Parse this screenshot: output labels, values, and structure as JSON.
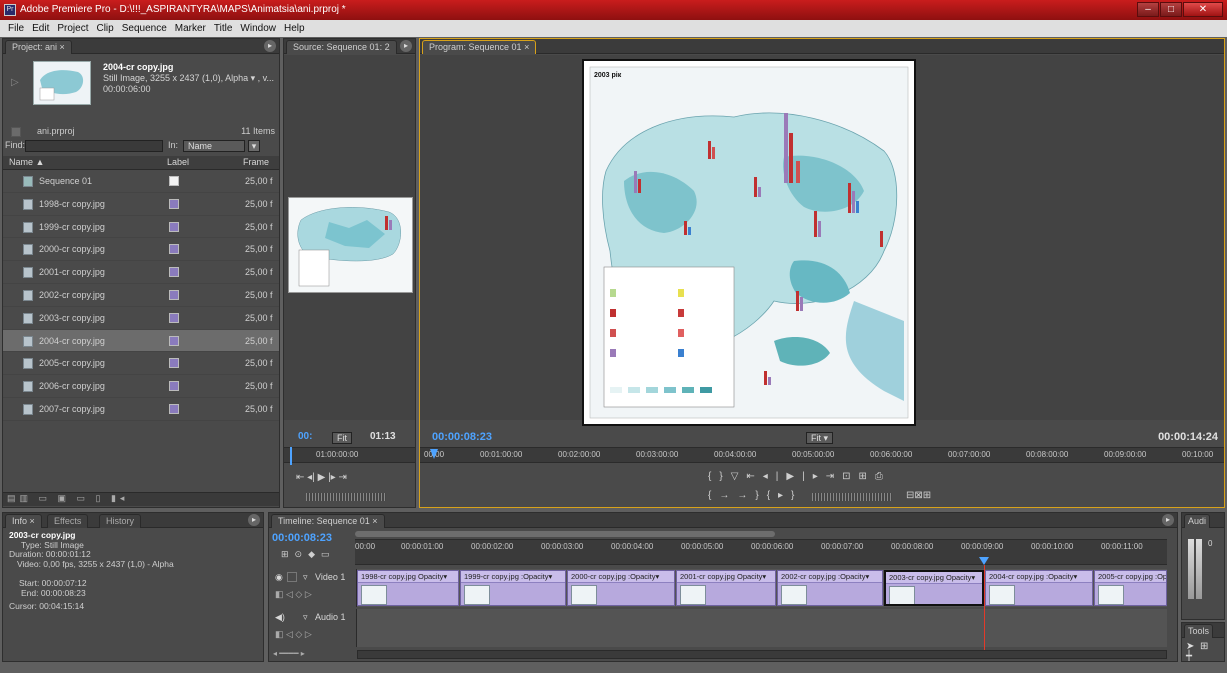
{
  "window": {
    "title": "Adobe Premiere Pro - D:\\!!!_ASPIRANTYRA\\MAPS\\Animatsia\\ani.prproj *",
    "app_icon": "Pr"
  },
  "menu": [
    "File",
    "Edit",
    "Project",
    "Clip",
    "Sequence",
    "Marker",
    "Title",
    "Window",
    "Help"
  ],
  "project": {
    "tab": "Project: ani",
    "selected_name": "2004-cr copy.jpg",
    "selected_detail": "Still Image, 3255 x 2437 (1,0), Alpha ▾ , v...",
    "selected_duration": "00:00:06:00",
    "file": "ani.prproj",
    "count": "11 Items",
    "find_label": "Find:",
    "in_label": "In:",
    "in_value": "Name",
    "col_name": "Name ▲",
    "col_label": "Label",
    "col_frame": "Frame",
    "items": [
      {
        "name": "Sequence 01",
        "frame": "25,00 f",
        "label": "white"
      },
      {
        "name": "1998-cr copy.jpg",
        "frame": "25,00 f",
        "label": "violet"
      },
      {
        "name": "1999-cr copy.jpg",
        "frame": "25,00 f",
        "label": "violet"
      },
      {
        "name": "2000-cr copy.jpg",
        "frame": "25,00 f",
        "label": "violet"
      },
      {
        "name": "2001-cr copy.jpg",
        "frame": "25,00 f",
        "label": "violet"
      },
      {
        "name": "2002-cr copy.jpg",
        "frame": "25,00 f",
        "label": "violet"
      },
      {
        "name": "2003-cr copy.jpg",
        "frame": "25,00 f",
        "label": "violet"
      },
      {
        "name": "2004-cr copy.jpg",
        "frame": "25,00 f",
        "label": "violet",
        "selected": true
      },
      {
        "name": "2005-cr copy.jpg",
        "frame": "25,00 f",
        "label": "violet"
      },
      {
        "name": "2006-cr copy.jpg",
        "frame": "25,00 f",
        "label": "violet"
      },
      {
        "name": "2007-cr copy.jpg",
        "frame": "25,00 f",
        "label": "violet"
      }
    ]
  },
  "source": {
    "tab": "Source: Sequence 01: 2",
    "tc_left": "00:",
    "fit": "Fit",
    "tc_right": "01:13",
    "ruler_tc": "01:00:00:00"
  },
  "program": {
    "tab": "Program: Sequence 01",
    "tc_current": "00:00:08:23",
    "fit": "Fit",
    "tc_duration": "00:00:14:24",
    "map_title": "2003 рік",
    "ruler": [
      "00:00",
      "00:01:00:00",
      "00:02:00:00",
      "00:03:00:00",
      "00:04:00:00",
      "00:05:00:00",
      "00:06:00:00",
      "00:07:00:00",
      "00:08:00:00",
      "00:09:00:00",
      "00:10:00"
    ]
  },
  "info": {
    "tabs": [
      "Info",
      "Effects",
      "History"
    ],
    "name": "2003-cr copy.jpg",
    "type": "Type: Still Image",
    "duration": "Duration: 00:00:01:12",
    "video": "Video: 0,00 fps, 3255 x 2437 (1,0) - Alpha",
    "start": "Start: 00:00:07:12",
    "end": "End: 00:00:08:23",
    "cursor": "Cursor: 00:04:15:14"
  },
  "timeline": {
    "tab": "Timeline: Sequence 01",
    "tc": "00:00:08:23",
    "ruler": [
      "00:00",
      "00:00:01:00",
      "00:00:02:00",
      "00:00:03:00",
      "00:00:04:00",
      "00:00:05:00",
      "00:00:06:00",
      "00:00:07:00",
      "00:00:08:00",
      "00:00:09:00",
      "00:00:10:00",
      "00:00:11:00"
    ],
    "video_track": "Video 1",
    "audio_track": "Audio 1",
    "clips": [
      {
        "name": "1998-cr copy.jpg",
        "fx": "Opacity▾"
      },
      {
        "name": "1999-cr copy.jpg",
        "fx": ":Opacity▾"
      },
      {
        "name": "2000-cr copy.jpg",
        "fx": ":Opacity▾"
      },
      {
        "name": "2001-cr copy.jpg",
        "fx": "Opacity▾"
      },
      {
        "name": "2002-cr copy.jpg",
        "fx": ":Opacity▾"
      },
      {
        "name": "2003-cr copy.jpg",
        "fx": "Opacity▾",
        "selected": true
      },
      {
        "name": "2004-cr copy.jpg",
        "fx": ":Opacity▾"
      },
      {
        "name": "2005-cr copy.jpg",
        "fx": ":Opacity▾"
      }
    ]
  },
  "audio_meter": {
    "tab": "Audi",
    "db": "0"
  },
  "tools": {
    "tab": "Tools"
  }
}
